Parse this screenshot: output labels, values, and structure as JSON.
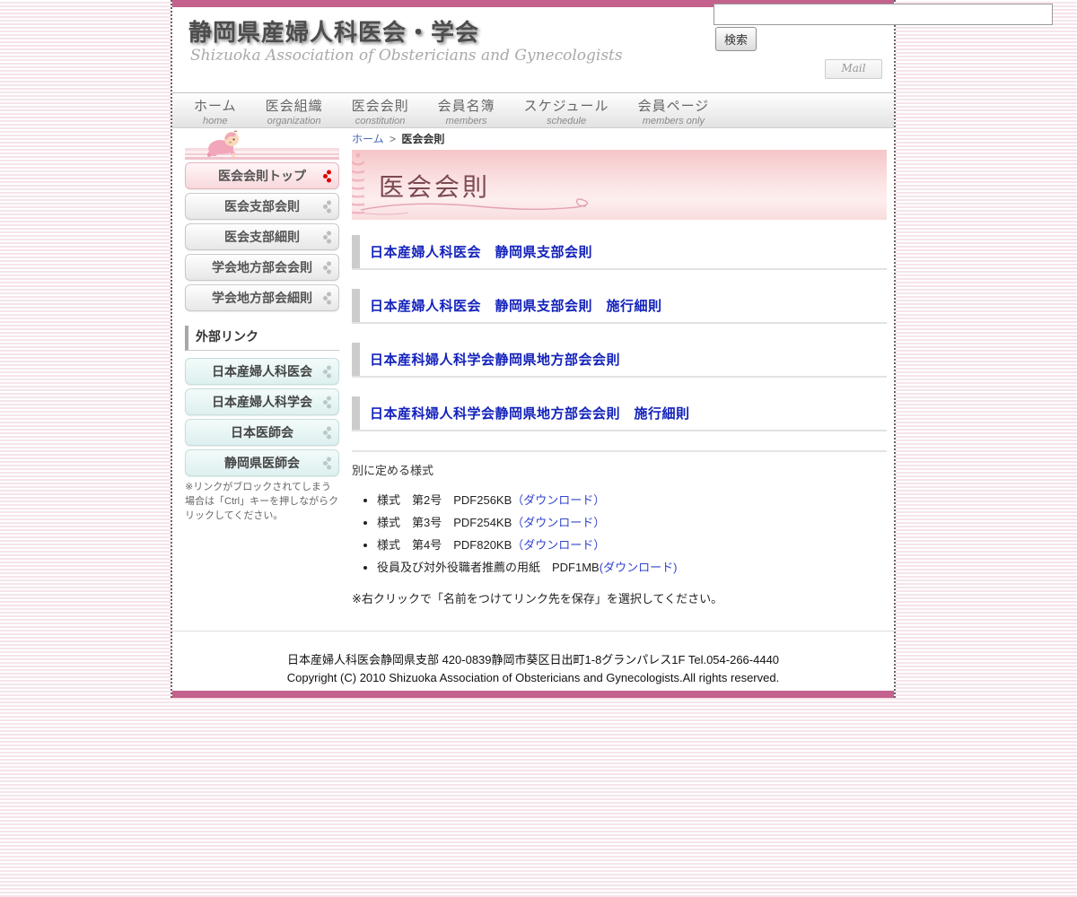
{
  "header": {
    "title": "静岡県産婦人科医会・学会",
    "subtitle": "Shizuoka Association of Obstericians and Gynecologists",
    "search_button": "検索",
    "mail_button": "Mail"
  },
  "nav": {
    "items": [
      {
        "jp": "ホーム",
        "en": "home"
      },
      {
        "jp": "医会組織",
        "en": "organization"
      },
      {
        "jp": "医会会則",
        "en": "constitution"
      },
      {
        "jp": "会員名簿",
        "en": "members"
      },
      {
        "jp": "スケジュール",
        "en": "schedule"
      },
      {
        "jp": "会員ページ",
        "en": "members only"
      }
    ]
  },
  "breadcrumb": {
    "home": "ホーム",
    "separator": ">",
    "current": "医会会則"
  },
  "page": {
    "title": "医会会則"
  },
  "sidebar": {
    "menu": [
      {
        "label": "医会会則トップ"
      },
      {
        "label": "医会支部会則"
      },
      {
        "label": "医会支部細則"
      },
      {
        "label": "学会地方部会会則"
      },
      {
        "label": "学会地方部会細則"
      }
    ],
    "external_heading": "外部リンク",
    "external_links": [
      {
        "label": "日本産婦人科医会"
      },
      {
        "label": "日本産婦人科学会"
      },
      {
        "label": "日本医師会"
      },
      {
        "label": "静岡県医師会"
      }
    ],
    "note": "※リンクがブロックされてしまう場合は「Ctrl」キーを押しながらクリックしてください。"
  },
  "main": {
    "headings": [
      {
        "label": "日本産婦人科医会　静岡県支部会則"
      },
      {
        "label": "日本産婦人科医会　静岡県支部会則　施行細則"
      },
      {
        "label": "日本産科婦人科学会静岡県地方部会会則"
      },
      {
        "label": "日本産科婦人科学会静岡県地方部会会則　施行細則"
      }
    ],
    "forms_heading": "別に定める様式",
    "forms": [
      {
        "label": "様式　第2号　PDF256KB",
        "link": "（ダウンロード）"
      },
      {
        "label": "様式　第3号　PDF254KB",
        "link": "（ダウンロード）"
      },
      {
        "label": "様式　第4号　PDF820KB",
        "link": "（ダウンロード）"
      },
      {
        "label": "役員及び対外役職者推薦の用紙　PDF1MB",
        "link": "(ダウンロード)"
      }
    ],
    "note": "※右クリックで「名前をつけてリンク先を保存」を選択してください。"
  },
  "footer": {
    "address": "日本産婦人科医会静岡県支部 420-0839静岡市葵区日出町1-8グランパレス1F Tel.054-266-4440",
    "copyright": "Copyright (C) 2010 Shizuoka Association of Obstericians and Gynecologists.All rights reserved."
  },
  "colors": {
    "accent_pink_bar": "#c4618c",
    "heading_link_blue": "#1322bb",
    "download_link_blue": "#3344cc",
    "banner_title_maroon": "#7d4950"
  }
}
